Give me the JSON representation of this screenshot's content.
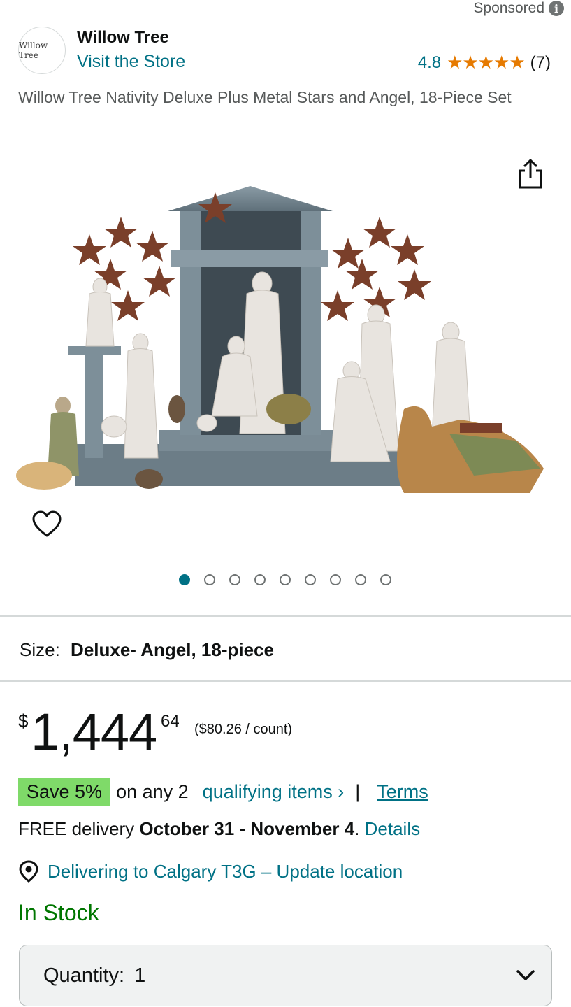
{
  "sponsored": {
    "label": "Sponsored",
    "icon": "info-icon"
  },
  "brand": {
    "logo_text": "Willow Tree",
    "name": "Willow Tree",
    "visit_store": "Visit the Store"
  },
  "rating": {
    "value": "4.8",
    "stars": "★★★★★",
    "count": "(7)",
    "color": "#e67a00"
  },
  "product": {
    "title": "Willow Tree Nativity Deluxe Plus Metal Stars and Angel, 18-Piece Set"
  },
  "gallery": {
    "image_count": 9,
    "active_index": 0,
    "share_icon": "share-icon",
    "wishlist_icon": "heart-icon"
  },
  "size": {
    "label": "Size:",
    "value": "Deluxe- Angel, 18-piece"
  },
  "price": {
    "symbol": "$",
    "whole": "1,444",
    "fraction": "64",
    "unit": "($80.26 / count)"
  },
  "promo": {
    "badge": "Save 5%",
    "text": "on any 2",
    "link": "qualifying items ›",
    "separator": "|",
    "terms": "Terms",
    "badge_color": "#7fda69"
  },
  "delivery": {
    "prefix": "FREE delivery",
    "dates": "October 31 - November 4",
    "period": ".",
    "details": "Details"
  },
  "location": {
    "text": "Delivering to Calgary T3G – Update location",
    "icon": "location-pin-icon"
  },
  "stock": {
    "text": "In Stock",
    "color": "#007600"
  },
  "quantity": {
    "label": "Quantity:",
    "value": "1",
    "icon": "chevron-down-icon"
  },
  "colors": {
    "link": "#007185",
    "accent_dot": "#007185"
  }
}
